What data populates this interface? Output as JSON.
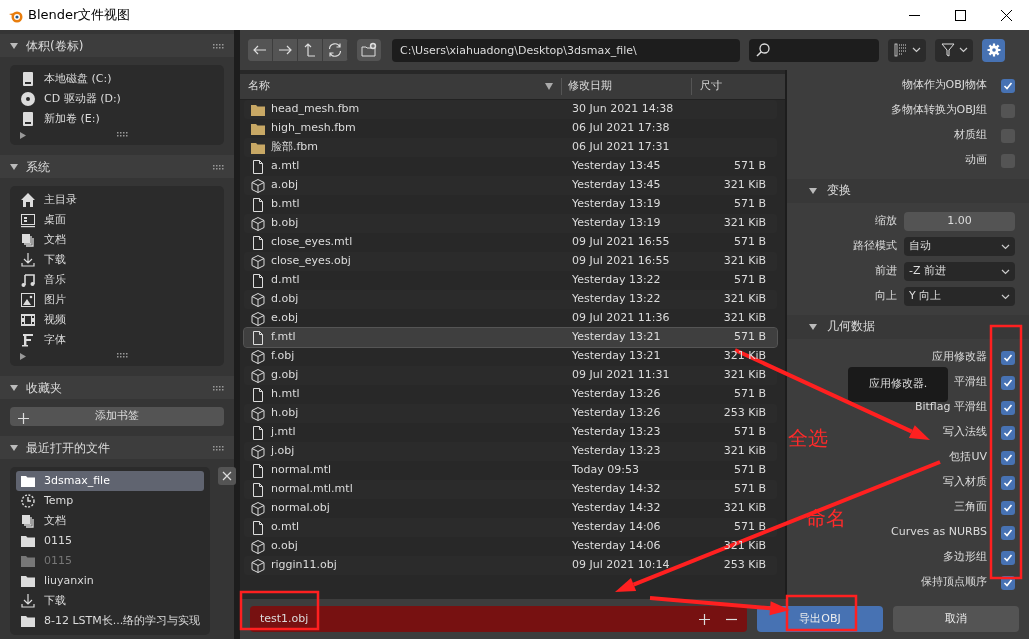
{
  "window": {
    "title": "Blender文件视图"
  },
  "sidebar": {
    "sections": [
      {
        "title": "体积(卷标)",
        "expanded": true,
        "items": [
          {
            "label": "本地磁盘 (C:)",
            "kind": "drive",
            "selected": false
          },
          {
            "label": "CD 驱动器 (D:)",
            "kind": "cd",
            "selected": false
          },
          {
            "label": "新加卷 (E:)",
            "kind": "drive",
            "selected": false
          }
        ]
      },
      {
        "title": "系统",
        "expanded": true,
        "items": [
          {
            "label": "主目录",
            "kind": "home",
            "selected": false
          },
          {
            "label": "桌面",
            "kind": "desktop",
            "selected": false
          },
          {
            "label": "文档",
            "kind": "documents",
            "selected": false
          },
          {
            "label": "下载",
            "kind": "download",
            "selected": false
          },
          {
            "label": "音乐",
            "kind": "music",
            "selected": false
          },
          {
            "label": "图片",
            "kind": "image",
            "selected": false
          },
          {
            "label": "视频",
            "kind": "video",
            "selected": false
          },
          {
            "label": "字体",
            "kind": "font",
            "selected": false
          }
        ]
      },
      {
        "title": "收藏夹",
        "expanded": true,
        "button": "添加书签"
      },
      {
        "title": "最近打开的文件",
        "expanded": true,
        "recent": [
          {
            "label": "3dsmax_file",
            "kind": "folder",
            "selected": true,
            "disabled": false
          },
          {
            "label": "Temp",
            "kind": "temp",
            "selected": false,
            "disabled": false
          },
          {
            "label": "文档",
            "kind": "documents",
            "selected": false,
            "disabled": false
          },
          {
            "label": "0115",
            "kind": "folder",
            "selected": false,
            "disabled": false
          },
          {
            "label": "0115",
            "kind": "folder",
            "selected": false,
            "disabled": true
          },
          {
            "label": "liuyanxin",
            "kind": "folder",
            "selected": false,
            "disabled": false
          },
          {
            "label": "下载",
            "kind": "download",
            "selected": false,
            "disabled": false
          },
          {
            "label": "8-12 LSTM长...络的学习与实现",
            "kind": "folder",
            "selected": false,
            "disabled": false
          }
        ]
      }
    ]
  },
  "toolbar": {
    "path": "C:\\Users\\xiahuadong\\Desktop\\3dsmax_file\\"
  },
  "file_list": {
    "columns": [
      "名称",
      "修改日期",
      "尺寸"
    ],
    "rows": [
      {
        "name": "head_mesh.fbm",
        "kind": "folder",
        "date": "30 Jun 2021 14:38",
        "selected": false
      },
      {
        "name": "high_mesh.fbm",
        "kind": "folder",
        "date": "06 Jul 2021 17:38",
        "selected": false
      },
      {
        "name": "脸部.fbm",
        "kind": "folder",
        "date": "06 Jul 2021 17:31",
        "selected": false
      },
      {
        "name": "a.mtl",
        "kind": "file",
        "date": "Yesterday 13:45",
        "size": "571 B",
        "selected": false
      },
      {
        "name": "a.obj",
        "kind": "obj",
        "date": "Yesterday 13:45",
        "size": "321 KiB",
        "selected": false
      },
      {
        "name": "b.mtl",
        "kind": "file",
        "date": "Yesterday 13:19",
        "size": "571 B",
        "selected": false
      },
      {
        "name": "b.obj",
        "kind": "obj",
        "date": "Yesterday 13:19",
        "size": "321 KiB",
        "selected": false
      },
      {
        "name": "close_eyes.mtl",
        "kind": "file",
        "date": "09 Jul 2021 16:55",
        "size": "571 B",
        "selected": false
      },
      {
        "name": "close_eyes.obj",
        "kind": "obj",
        "date": "09 Jul 2021 16:55",
        "size": "321 KiB",
        "selected": false
      },
      {
        "name": "d.mtl",
        "kind": "file",
        "date": "Yesterday 13:22",
        "size": "571 B",
        "selected": false
      },
      {
        "name": "d.obj",
        "kind": "obj",
        "date": "Yesterday 13:22",
        "size": "321 KiB",
        "selected": false
      },
      {
        "name": "e.obj",
        "kind": "obj",
        "date": "09 Jul 2021 11:36",
        "size": "321 KiB",
        "selected": false
      },
      {
        "name": "f.mtl",
        "kind": "file",
        "date": "Yesterday 13:21",
        "size": "571 B",
        "selected": true
      },
      {
        "name": "f.obj",
        "kind": "obj",
        "date": "Yesterday 13:21",
        "size": "321 KiB",
        "selected": false
      },
      {
        "name": "g.obj",
        "kind": "obj",
        "date": "09 Jul 2021 11:31",
        "size": "321 KiB",
        "selected": false
      },
      {
        "name": "h.mtl",
        "kind": "file",
        "date": "Yesterday 13:26",
        "size": "571 B",
        "selected": false
      },
      {
        "name": "h.obj",
        "kind": "obj",
        "date": "Yesterday 13:26",
        "size": "253 KiB",
        "selected": false
      },
      {
        "name": "j.mtl",
        "kind": "file",
        "date": "Yesterday 13:23",
        "size": "571 B",
        "selected": false
      },
      {
        "name": "j.obj",
        "kind": "obj",
        "date": "Yesterday 13:23",
        "size": "321 KiB",
        "selected": false
      },
      {
        "name": "normal.mtl",
        "kind": "file",
        "date": "Today 09:53",
        "size": "571 B",
        "selected": false
      },
      {
        "name": "normal.mtl.mtl",
        "kind": "file",
        "date": "Yesterday 14:32",
        "size": "571 B",
        "selected": false
      },
      {
        "name": "normal.obj",
        "kind": "obj",
        "date": "Yesterday 14:32",
        "size": "321 KiB",
        "selected": false
      },
      {
        "name": "o.mtl",
        "kind": "file",
        "date": "Yesterday 14:06",
        "size": "571 B",
        "selected": false
      },
      {
        "name": "o.obj",
        "kind": "obj",
        "date": "Yesterday 14:06",
        "size": "321 KiB",
        "selected": false
      },
      {
        "name": "riggin11.obj",
        "kind": "obj",
        "date": "09 Jul 2021 10:14",
        "size": "253 KiB",
        "selected": false
      }
    ]
  },
  "settings": {
    "options_top": [
      {
        "label": "物体作为OBJ物体",
        "checked": true
      },
      {
        "label": "多物体转换为OBJ组",
        "checked": false
      },
      {
        "label": "材质组",
        "checked": false
      },
      {
        "label": "动画",
        "checked": false
      }
    ],
    "sections": [
      {
        "title": "变换",
        "expanded": true,
        "fields": [
          {
            "label": "缩放",
            "kind": "number",
            "value": "1.00"
          },
          {
            "label": "路径模式",
            "kind": "select",
            "value": "自动"
          },
          {
            "label": "前进",
            "kind": "select",
            "value": "-Z 前进"
          },
          {
            "label": "向上",
            "kind": "select",
            "value": "Y 向上"
          }
        ]
      },
      {
        "title": "几何数据",
        "expanded": true,
        "options": [
          {
            "label": "应用修改器",
            "checked": true
          },
          {
            "label": "平滑组",
            "checked": true
          },
          {
            "label": "Bitflag 平滑组",
            "checked": true
          },
          {
            "label": "写入法线",
            "checked": true
          },
          {
            "label": "包括UV",
            "checked": true
          },
          {
            "label": "写入材质",
            "checked": true
          },
          {
            "label": "三角面",
            "checked": true
          },
          {
            "label": "Curves as NURBS",
            "checked": true
          },
          {
            "label": "多边形组",
            "checked": true
          },
          {
            "label": "保持顶点顺序",
            "checked": true
          }
        ]
      }
    ],
    "tooltip": "应用修改器."
  },
  "bottom_bar": {
    "filename": "test1.obj",
    "exists": true,
    "buttons": [
      {
        "label": "导出OBJ",
        "kind": "primary"
      },
      {
        "label": "取消",
        "kind": "secondary"
      }
    ]
  },
  "annotations": {
    "labels": [
      "全选",
      "命名"
    ]
  }
}
